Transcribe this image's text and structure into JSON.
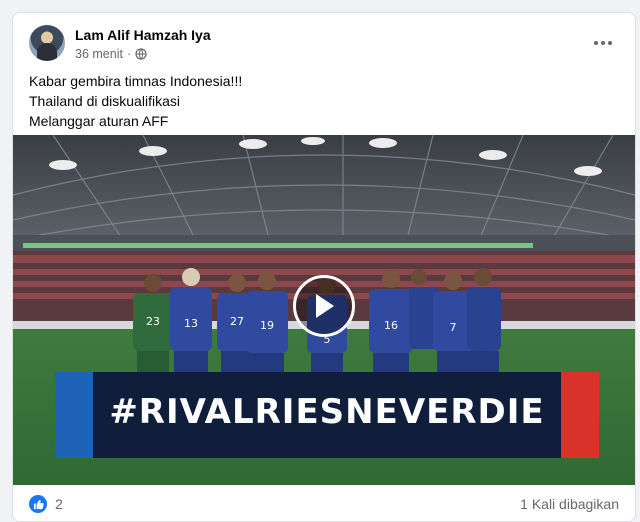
{
  "post": {
    "author": "Lam Alif Hamzah Iya",
    "time": "36 menit",
    "audience_icon": "globe-icon",
    "lines": [
      "Kabar gembira timnas Indonesia!!!",
      "Thailand di diskualifikasi",
      "Melanggar aturan AFF"
    ]
  },
  "media": {
    "banner_text": "#RIVALRIESNEVERDIE",
    "play_icon": "play-icon",
    "jersey_numbers": [
      "23",
      "13",
      "27",
      "19",
      "5",
      "16",
      "7"
    ]
  },
  "footer": {
    "reaction_icon": "like-icon",
    "reaction_count": "2",
    "shares": "1 Kali dibagikan"
  },
  "colors": {
    "accent": "#1877f2",
    "banner": "#101e3b",
    "kit_blue": "#2f4a9e",
    "keeper_green": "#2f6b3c"
  }
}
